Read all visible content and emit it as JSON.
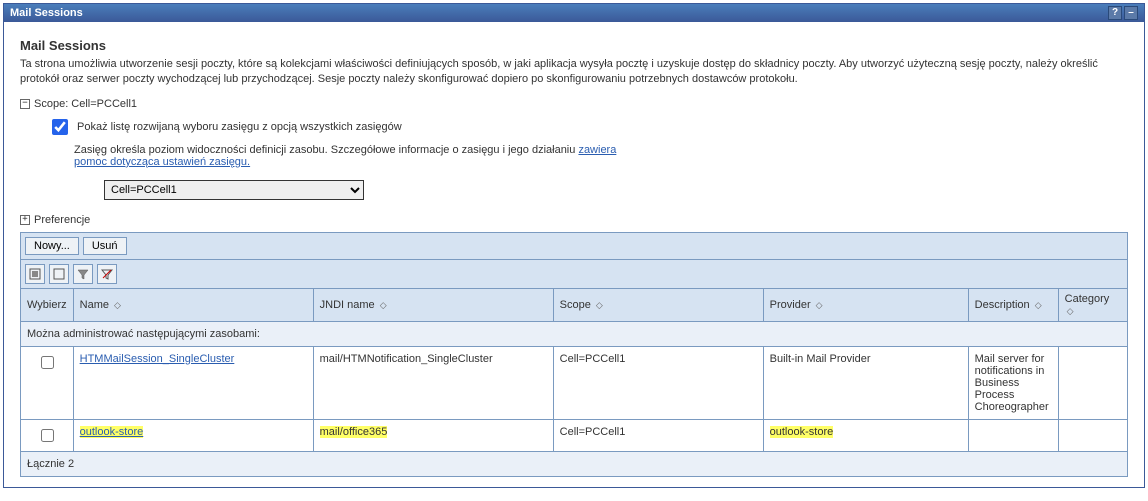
{
  "window": {
    "title": "Mail Sessions"
  },
  "page": {
    "title": "Mail Sessions",
    "description": "Ta strona umożliwia utworzenie sesji poczty, które są kolekcjami właściwości definiujących sposób, w jaki aplikacja wysyła pocztę i uzyskuje dostęp do składnicy poczty. Aby utworzyć użyteczną sesję poczty, należy określić protokół oraz serwer poczty wychodzącej lub przychodzącej. Sesje poczty należy skonfigurować dopiero po skonfigurowaniu potrzebnych dostawców protokołu."
  },
  "scope": {
    "label": "Scope: Cell=PCCell1",
    "checkbox_label": "Pokaż listę rozwijaną wyboru zasięgu z opcją wszystkich zasięgów",
    "help_text": "Zasięg określa poziom widoczności definicji zasobu. Szczegółowe informacje o zasięgu i jego działaniu ",
    "help_link1": "zawiera",
    "help_link2": "pomoc dotycząca ustawień zasięgu.",
    "selected": "Cell=PCCell1"
  },
  "prefs_label": "Preferencje",
  "buttons": {
    "new": "Nowy...",
    "delete": "Usuń"
  },
  "columns": {
    "select": "Wybierz",
    "name": "Name",
    "jndi": "JNDI name",
    "scope": "Scope",
    "provider": "Provider",
    "description": "Description",
    "category": "Category"
  },
  "subhead": "Można administrować następującymi zasobami:",
  "rows": [
    {
      "name": "HTMMailSession_SingleCluster",
      "jndi": "mail/HTMNotification_SingleCluster",
      "scope": "Cell=PCCell1",
      "provider": "Built-in Mail Provider",
      "description": "Mail server for notifications in Business Process Choreographer",
      "category": "",
      "highlight": false
    },
    {
      "name": "outlook-store",
      "jndi": "mail/office365",
      "scope": "Cell=PCCell1",
      "provider": "outlook-store",
      "description": "",
      "category": "",
      "highlight": true
    }
  ],
  "footer": "Łącznie 2"
}
